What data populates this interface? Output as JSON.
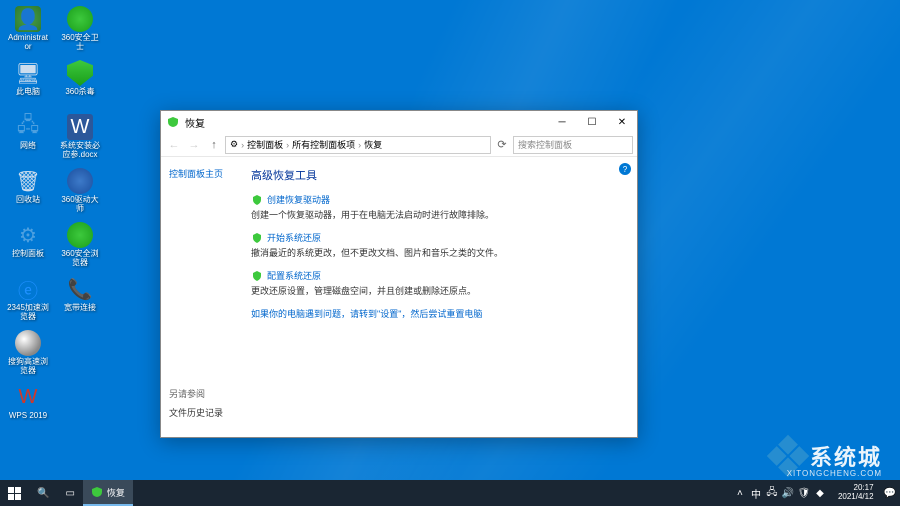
{
  "desktop": {
    "icons_col1": [
      {
        "name": "administrator",
        "label": "Administrator",
        "icon": "user"
      },
      {
        "name": "this-pc",
        "label": "此电脑",
        "icon": "pc"
      },
      {
        "name": "network",
        "label": "网络",
        "icon": "net"
      },
      {
        "name": "recycle-bin",
        "label": "回收站",
        "icon": "bin"
      },
      {
        "name": "control-panel",
        "label": "控制面板",
        "icon": "cp"
      },
      {
        "name": "2345-browser",
        "label": "2345加速浏览器",
        "icon": "ie"
      },
      {
        "name": "sogou-browser",
        "label": "搜狗高速浏览器",
        "icon": "sogou"
      },
      {
        "name": "wps-2019",
        "label": "WPS 2019",
        "icon": "wps"
      }
    ],
    "icons_col2": [
      {
        "name": "360-guard",
        "label": "360安全卫士",
        "icon": "360"
      },
      {
        "name": "360-av",
        "label": "360杀毒",
        "icon": "shield"
      },
      {
        "name": "sys-req",
        "label": "系统安装必应参.docx",
        "icon": "word"
      },
      {
        "name": "360-driver",
        "label": "360驱动大师",
        "icon": "360d"
      },
      {
        "name": "360-browser",
        "label": "360安全浏览器",
        "icon": "360b"
      },
      {
        "name": "dialup",
        "label": "宽带连接",
        "icon": "dial"
      }
    ]
  },
  "window": {
    "title": "恢复",
    "breadcrumb": [
      "控制面板",
      "所有控制面板项",
      "恢复"
    ],
    "search_placeholder": "搜索控制面板",
    "sidebar_home": "控制面板主页",
    "section_title": "高级恢复工具",
    "tools": [
      {
        "link": "创建恢复驱动器",
        "desc": "创建一个恢复驱动器，用于在电脑无法启动时进行故障排除。"
      },
      {
        "link": "开始系统还原",
        "desc": "撤消最近的系统更改，但不更改文档、图片和音乐之类的文件。"
      },
      {
        "link": "配置系统还原",
        "desc": "更改还原设置，管理磁盘空间，并且创建或删除还原点。"
      }
    ],
    "hint": "如果你的电脑遇到问题，请转到\"设置\"，然后尝试重置电脑",
    "related_hdr": "另请参阅",
    "related_link": "文件历史记录"
  },
  "taskbar": {
    "active_app": "恢复",
    "time": "20:17",
    "date": "2021/4/12"
  },
  "watermark": {
    "text": "系统城",
    "sub": "XITONGCHENG.COM"
  }
}
